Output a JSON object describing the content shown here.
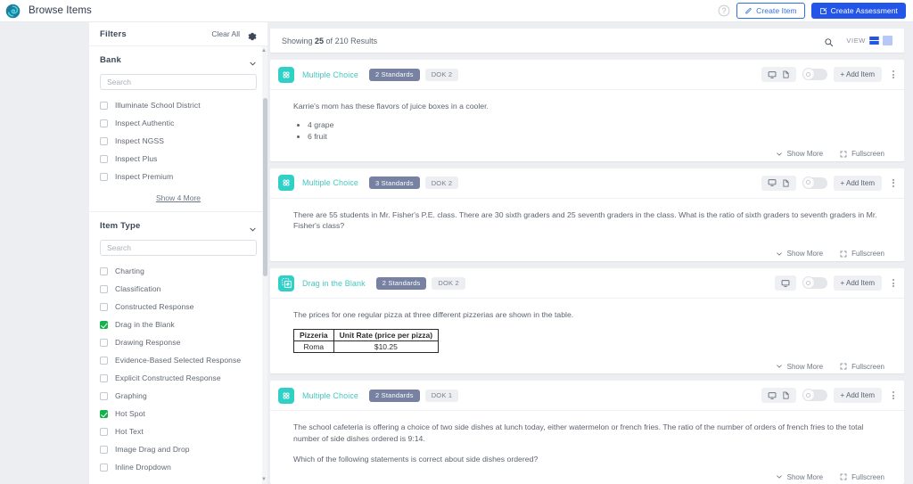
{
  "topbar": {
    "brand_title": "Browse Items",
    "logo_icon": "illuminate-swirl-logo",
    "help_icon": "help-circle-icon",
    "create_item_label": "Create Item",
    "create_item_icon": "pencil-item-icon",
    "create_assessment_label": "Create Assessment",
    "create_assessment_icon": "edit-document-icon",
    "primary_color": "#2356e8",
    "outline_color": "#2f6fe4"
  },
  "sidebar": {
    "title": "Filters",
    "clear_all_label": "Clear All",
    "gear_icon": "gear-icon",
    "facets": [
      {
        "title": "Bank",
        "chevron_icon": "chevron-down-icon",
        "search_placeholder": "Search",
        "search_value": "",
        "options": [
          {
            "label": "Illuminate School District",
            "checked": false
          },
          {
            "label": "Inspect Authentic",
            "checked": false
          },
          {
            "label": "Inspect NGSS",
            "checked": false
          },
          {
            "label": "Inspect Plus",
            "checked": false
          },
          {
            "label": "Inspect Premium",
            "checked": false
          }
        ],
        "show_more_label": "Show 4 More"
      },
      {
        "title": "Item Type",
        "chevron_icon": "chevron-down-icon",
        "search_placeholder": "Search",
        "search_value": "",
        "options": [
          {
            "label": "Charting",
            "checked": false
          },
          {
            "label": "Classification",
            "checked": false
          },
          {
            "label": "Constructed Response",
            "checked": false
          },
          {
            "label": "Drag in the Blank",
            "checked": true
          },
          {
            "label": "Drawing Response",
            "checked": false
          },
          {
            "label": "Evidence-Based Selected Response",
            "checked": false
          },
          {
            "label": "Explicit Constructed Response",
            "checked": false
          },
          {
            "label": "Graphing",
            "checked": false
          },
          {
            "label": "Hot Spot",
            "checked": true
          },
          {
            "label": "Hot Text",
            "checked": false
          },
          {
            "label": "Image Drag and Drop",
            "checked": false
          },
          {
            "label": "Inline Dropdown",
            "checked": false
          }
        ]
      }
    ]
  },
  "results": {
    "showing_prefix": "Showing ",
    "showing_count": "25",
    "showing_middle": " of ",
    "total": "210",
    "showing_suffix": " Results",
    "search_icon": "search-icon",
    "view_label": "VIEW",
    "view_list_icon": "list-view-icon",
    "view_grid_icon": "grid-view-icon",
    "active_view": "list"
  },
  "card_common": {
    "preview_icon": "monitor-preview-icon",
    "doc_icon": "document-preview-icon",
    "toggle_icon": "lock-toggle-knob",
    "add_item_label": "+ Add Item",
    "kebab_icon": "more-vertical-icon",
    "show_more_label": "Show More",
    "show_more_icon": "chevron-down-icon",
    "fullscreen_label": "Fullscreen",
    "fullscreen_icon": "fullscreen-icon"
  },
  "cards": [
    {
      "type_label": "Multiple Choice",
      "type_icon": "multiple-choice-icon",
      "standards_badge": "2 Standards",
      "dok_badge": "DOK 2",
      "has_doc_icon": true,
      "body_text": "Karrie's mom has these flavors of juice boxes in a cooler.",
      "bullets": [
        "4 grape",
        "6 fruit"
      ]
    },
    {
      "type_label": "Multiple Choice",
      "type_icon": "multiple-choice-icon",
      "standards_badge": "3 Standards",
      "dok_badge": "DOK 2",
      "has_doc_icon": true,
      "body_text": "There are 55 students in Mr. Fisher's P.E. class.  There are 30 sixth graders and 25 seventh graders in the class.  What is the ratio of sixth graders to seventh graders in Mr. Fisher's class?"
    },
    {
      "type_label": "Drag in the Blank",
      "type_icon": "drag-in-the-blank-icon",
      "standards_badge": "2 Standards",
      "dok_badge": "DOK 2",
      "has_doc_icon": false,
      "body_text": "The prices for one regular pizza at three different pizzerias are shown in the table.",
      "table": {
        "headers": [
          "Pizzeria",
          "Unit Rate (price per pizza)"
        ],
        "rows": [
          [
            "Roma",
            "$10.25"
          ]
        ]
      }
    },
    {
      "type_label": "Multiple Choice",
      "type_icon": "multiple-choice-icon",
      "standards_badge": "2 Standards",
      "dok_badge": "DOK 1",
      "has_doc_icon": true,
      "body_text": "The school cafeteria is offering a choice of two side dishes at lunch today, either watermelon or french fries. The ratio of the number of orders of french fries to the total number of side dishes ordered is 9:14.",
      "body_text2": "Which of the following statements is correct about side dishes ordered?"
    }
  ]
}
